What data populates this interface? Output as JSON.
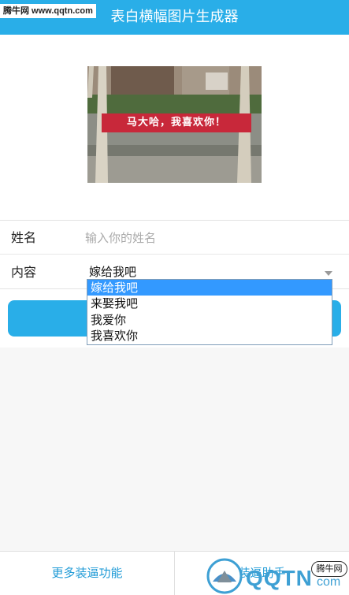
{
  "header": {
    "title": "表白横幅图片生成器",
    "watermark": "腾牛网 www.qqtn.com"
  },
  "preview": {
    "banner_text": "马大哈，我喜欢你！"
  },
  "form": {
    "name_label": "姓名",
    "name_placeholder": "输入你的姓名",
    "name_value": "",
    "content_label": "内容",
    "content_selected": "嫁给我吧",
    "content_options": [
      "嫁给我吧",
      "来娶我吧",
      "我爱你",
      "我喜欢你"
    ]
  },
  "bottom_bar": {
    "more_features": "更多装逼功能",
    "right_link_partial": "装逼助手"
  },
  "watermark_bottom": {
    "brand": "QQTN",
    "suffix": "com",
    "badge": "腾牛网"
  },
  "colors": {
    "accent": "#29aee8",
    "selection": "#3399ff",
    "link": "#1e9ad6"
  }
}
